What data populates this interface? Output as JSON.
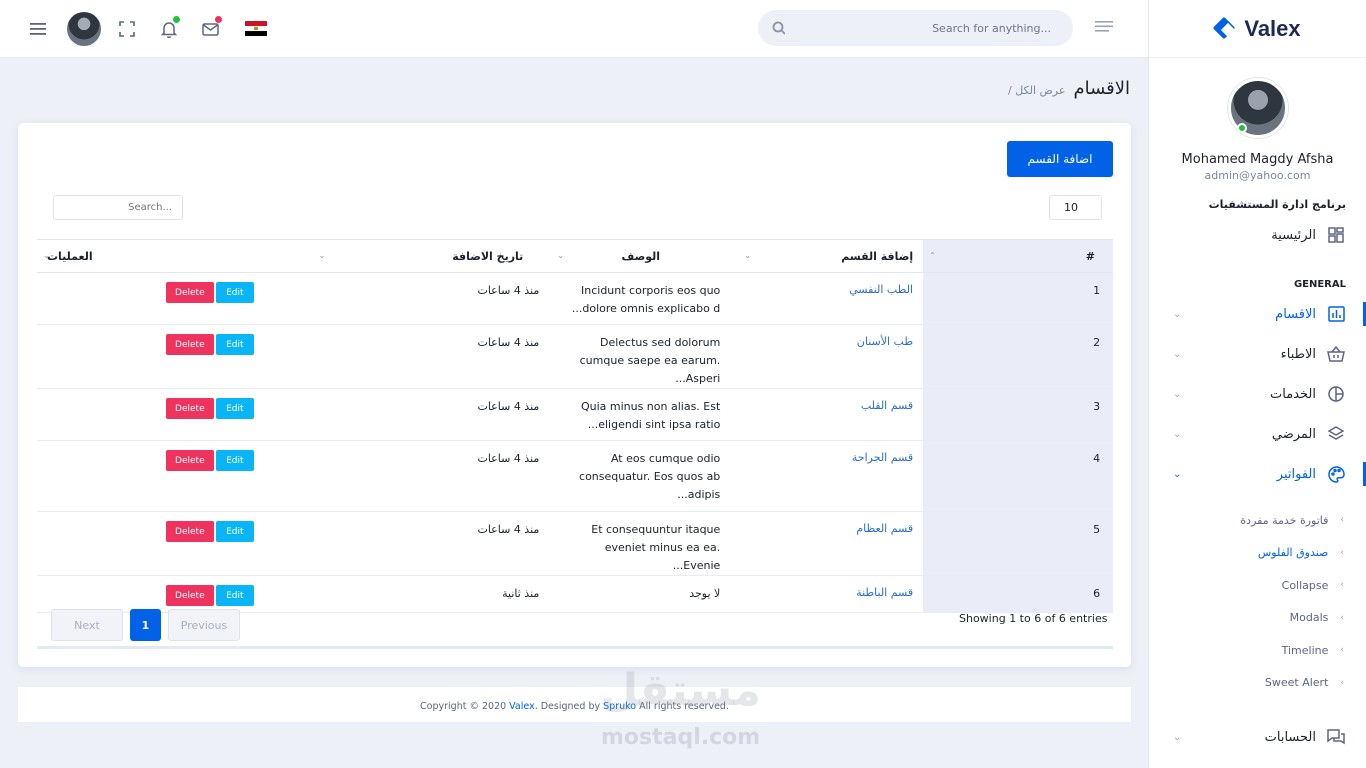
{
  "brand": {
    "name": "Valex",
    "accent": "#0162e8"
  },
  "user": {
    "name": "Mohamed Magdy Afsha",
    "email": "admin@yahoo.com"
  },
  "topbar": {
    "search_placeholder": "Search for anything..."
  },
  "sidebar": {
    "app_category": "برنامج ادارة المستشفيات",
    "home": "الرئيسية",
    "section_heading": "GENERAL",
    "items": [
      {
        "label": "الاقسام",
        "icon": "bar-chart-icon"
      },
      {
        "label": "الاطباء",
        "icon": "basket-icon"
      },
      {
        "label": "الخدمات",
        "icon": "pie-chart-icon"
      },
      {
        "label": "المرضي",
        "icon": "layers-icon"
      },
      {
        "label": "الفواتير",
        "icon": "palette-icon"
      }
    ],
    "sub_items": [
      "فاتورة خدمة مفردة",
      "صندوق الفلوس",
      "Collapse",
      "Modals",
      "Timeline",
      "Sweet Alert"
    ],
    "accounts": "الحسابات"
  },
  "page": {
    "title": "الاقسام",
    "crumb": "/ عرض الكل"
  },
  "card": {
    "add_button": "اضافة القسم",
    "page_length": "10",
    "search_placeholder": "Search...",
    "columns": [
      "#",
      "إضافة القسم",
      "الوصف",
      "تاريخ الاضافة",
      "العمليات"
    ],
    "rows": [
      {
        "num": "1",
        "name": "الطب النفسي",
        "desc": "Incidunt corporis eos quo dolore omnis explicabo d...",
        "date": "منذ 4 ساعات"
      },
      {
        "num": "2",
        "name": "طب الأسنان",
        "desc": "Delectus sed dolorum cumque saepe ea earum. Asperi...",
        "date": "منذ 4 ساعات"
      },
      {
        "num": "3",
        "name": "قسم القلب",
        "desc": "Quia minus non alias. Est eligendi sint ipsa ratio...",
        "date": "منذ 4 ساعات"
      },
      {
        "num": "4",
        "name": "قسم الجراحة",
        "desc": "At eos cumque odio consequatur. Eos quos ab adipis...",
        "date": "منذ 4 ساعات"
      },
      {
        "num": "5",
        "name": "قسم العظام",
        "desc": "Et consequuntur itaque eveniet minus ea ea. Evenie...",
        "date": "منذ 4 ساعات"
      },
      {
        "num": "6",
        "name": "قسم الباطنة",
        "desc": "لا يوجد",
        "date": "منذ ثانية"
      }
    ],
    "edit_label": "Edit",
    "delete_label": "Delete",
    "info": "Showing 1 to 6 of 6 entries",
    "pager": {
      "next": "Next",
      "current": "1",
      "previous": "Previous"
    }
  },
  "footer": {
    "prefix": "Copyright © 2020 ",
    "brand": "Valex",
    "middle": ". Designed by ",
    "designer": "Spruko",
    "suffix": " All rights reserved."
  },
  "watermark": {
    "text": "مستقل",
    "domain": "mostaql.com"
  }
}
